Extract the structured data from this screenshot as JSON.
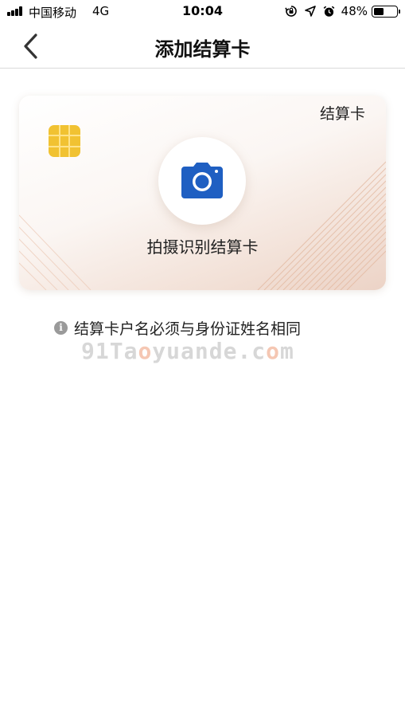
{
  "status_bar": {
    "carrier": "中国移动",
    "network": "4G",
    "time": "10:04",
    "battery_percent": "48%",
    "battery_level": 0.48,
    "icons": [
      "signal-icon",
      "orientation-lock-icon",
      "location-arrow-icon",
      "alarm-icon",
      "battery-icon"
    ]
  },
  "nav": {
    "title": "添加结算卡",
    "back_icon": "chevron-left-icon"
  },
  "card": {
    "label": "结算卡",
    "scan_text": "拍摄识别结算卡",
    "camera_icon": "camera-icon",
    "chip_icon": "card-chip-icon"
  },
  "info": {
    "icon": "info-icon",
    "text": "结算卡户名必须与身份证姓名相同"
  },
  "watermark": {
    "part1": "91Ta",
    "part2": "o",
    "part3": "yuande.c",
    "part4": "o",
    "part5": "m"
  },
  "colors": {
    "camera_blue": "#1f5fc2",
    "chip_gold": "#f1c232",
    "text": "#222222",
    "divider": "#d9d9d9"
  }
}
